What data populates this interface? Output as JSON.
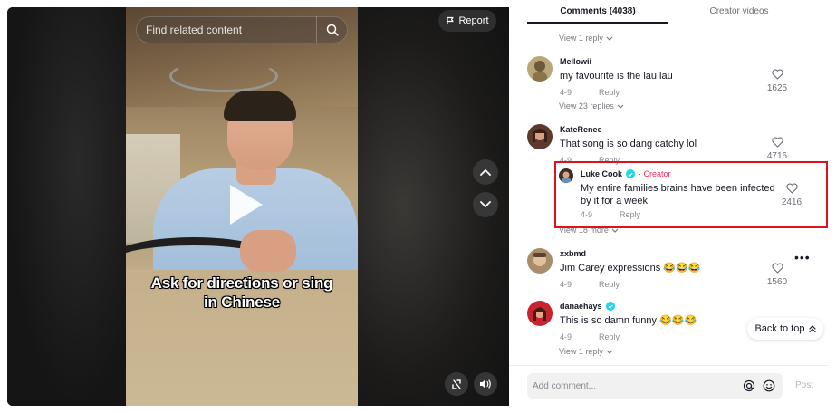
{
  "video": {
    "search_placeholder": "Find related content",
    "report_label": "Report",
    "caption_line1": "Ask for directions or sing",
    "caption_line2": "in Chinese"
  },
  "tabs": {
    "comments": "Comments (4038)",
    "creator": "Creator videos"
  },
  "comments": {
    "top_view_reply": "View 1 reply",
    "c1": {
      "user": "Mellowii",
      "text": "my favourite is the lau lau",
      "date": "4-9",
      "reply": "Reply",
      "likes": "1625",
      "view_replies": "View 23 replies"
    },
    "c2": {
      "user": "KateRenee",
      "text": "That song is so dang catchy lol",
      "date": "4-9",
      "reply": "Reply",
      "likes": "4716",
      "sub": {
        "user": "Luke Cook",
        "creator_tag": "Creator",
        "text": "My entire families brains have been infected by it for a week",
        "date": "4-9",
        "reply": "Reply",
        "likes": "2416"
      },
      "view_more": "View 18 more"
    },
    "c3": {
      "user": "xxbmd",
      "text": "Jim Carey expressions 😂😂😂",
      "date": "4-9",
      "reply": "Reply",
      "likes": "1560"
    },
    "c4": {
      "user": "danaehays",
      "text": "This is so damn funny 😂😂😂",
      "date": "4-9",
      "reply": "Reply",
      "view_replies": "View 1 reply"
    }
  },
  "back_to_top": "Back to top",
  "footer": {
    "input_placeholder": "Add comment...",
    "post_label": "Post"
  },
  "colors": {
    "accent": "#fe2c55",
    "highlight_box": "#d9131f",
    "verified": "#20d5ec"
  }
}
